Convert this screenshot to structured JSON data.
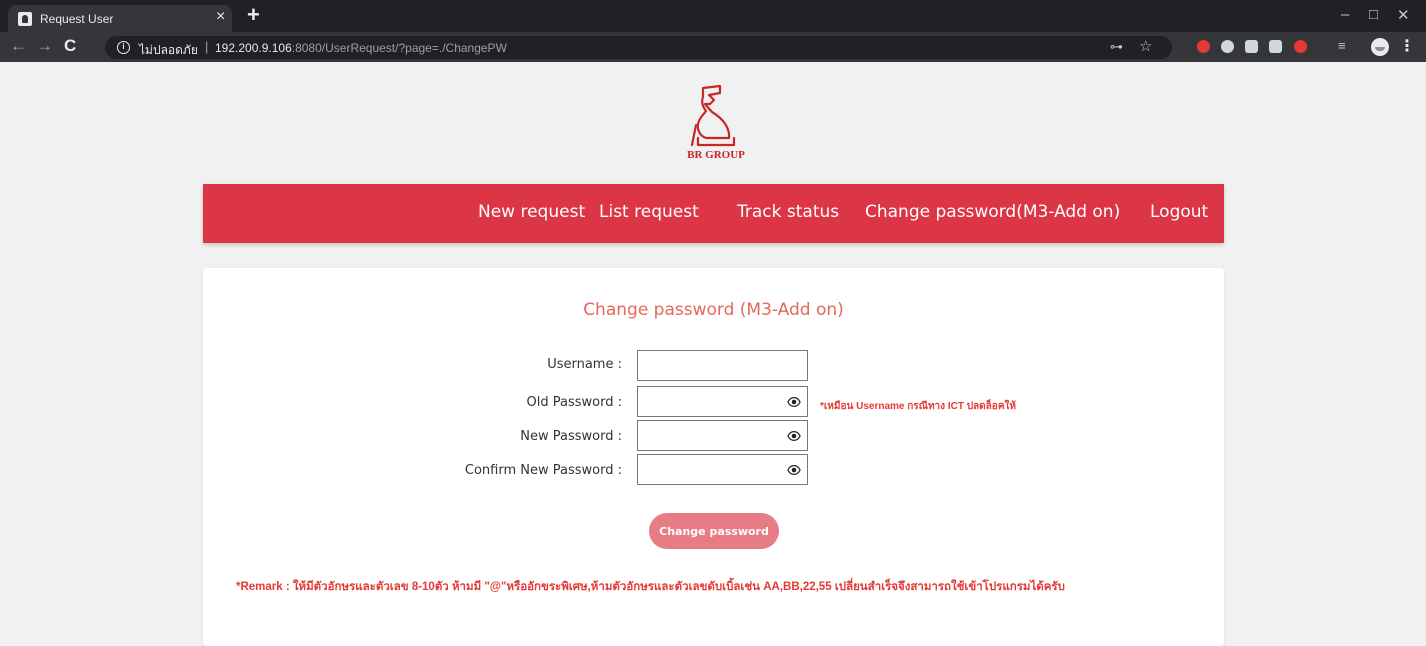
{
  "browser": {
    "tab_title": "Request User",
    "tab_close": "×",
    "new_tab": "+",
    "security_label": "ไม่ปลอดภัย",
    "separator": "|",
    "url_host": "192.200.9.106",
    "url_rest": ":8080/UserRequest/?page=./ChangePW",
    "back": "←",
    "forward": "→",
    "reload": "C",
    "key_icon": "⊶",
    "star_icon": "☆",
    "window_min": "–",
    "window_max": "□",
    "window_close": "✕",
    "menu": "⋮",
    "reading_list": "≡"
  },
  "logo": {
    "text": "BR GROUP",
    "color": "#c62828"
  },
  "nav": {
    "items": [
      {
        "label": "New request"
      },
      {
        "label": "List request"
      },
      {
        "label": "Track status"
      },
      {
        "label": "Change password(M3-Add on)"
      },
      {
        "label": "Logout"
      }
    ],
    "bg_color": "#dc3545"
  },
  "form": {
    "title": "Change password (M3-Add on)",
    "fields": [
      {
        "label": "Username :",
        "value": ""
      },
      {
        "label": "Old Password :",
        "value": ""
      },
      {
        "label": "New Password :",
        "value": ""
      },
      {
        "label": "Confirm New Password :",
        "value": ""
      }
    ],
    "hint": "*เหมือน Username กรณีทาง ICT ปลดล็อคให้",
    "submit_label": "Change password",
    "remark": "*Remark : ให้มีตัวอักษรและตัวเลข 8-10ตัว  ห้ามมี \"@\"หรืออักขระพิเศษ,ห้ามตัวอักษรและตัวเลขดับเบิ้ลเช่น AA,BB,22,55 เปลี่ยนสำเร็จจึงสามารถใช้เข้าโปรแกรมได้ครับ"
  }
}
